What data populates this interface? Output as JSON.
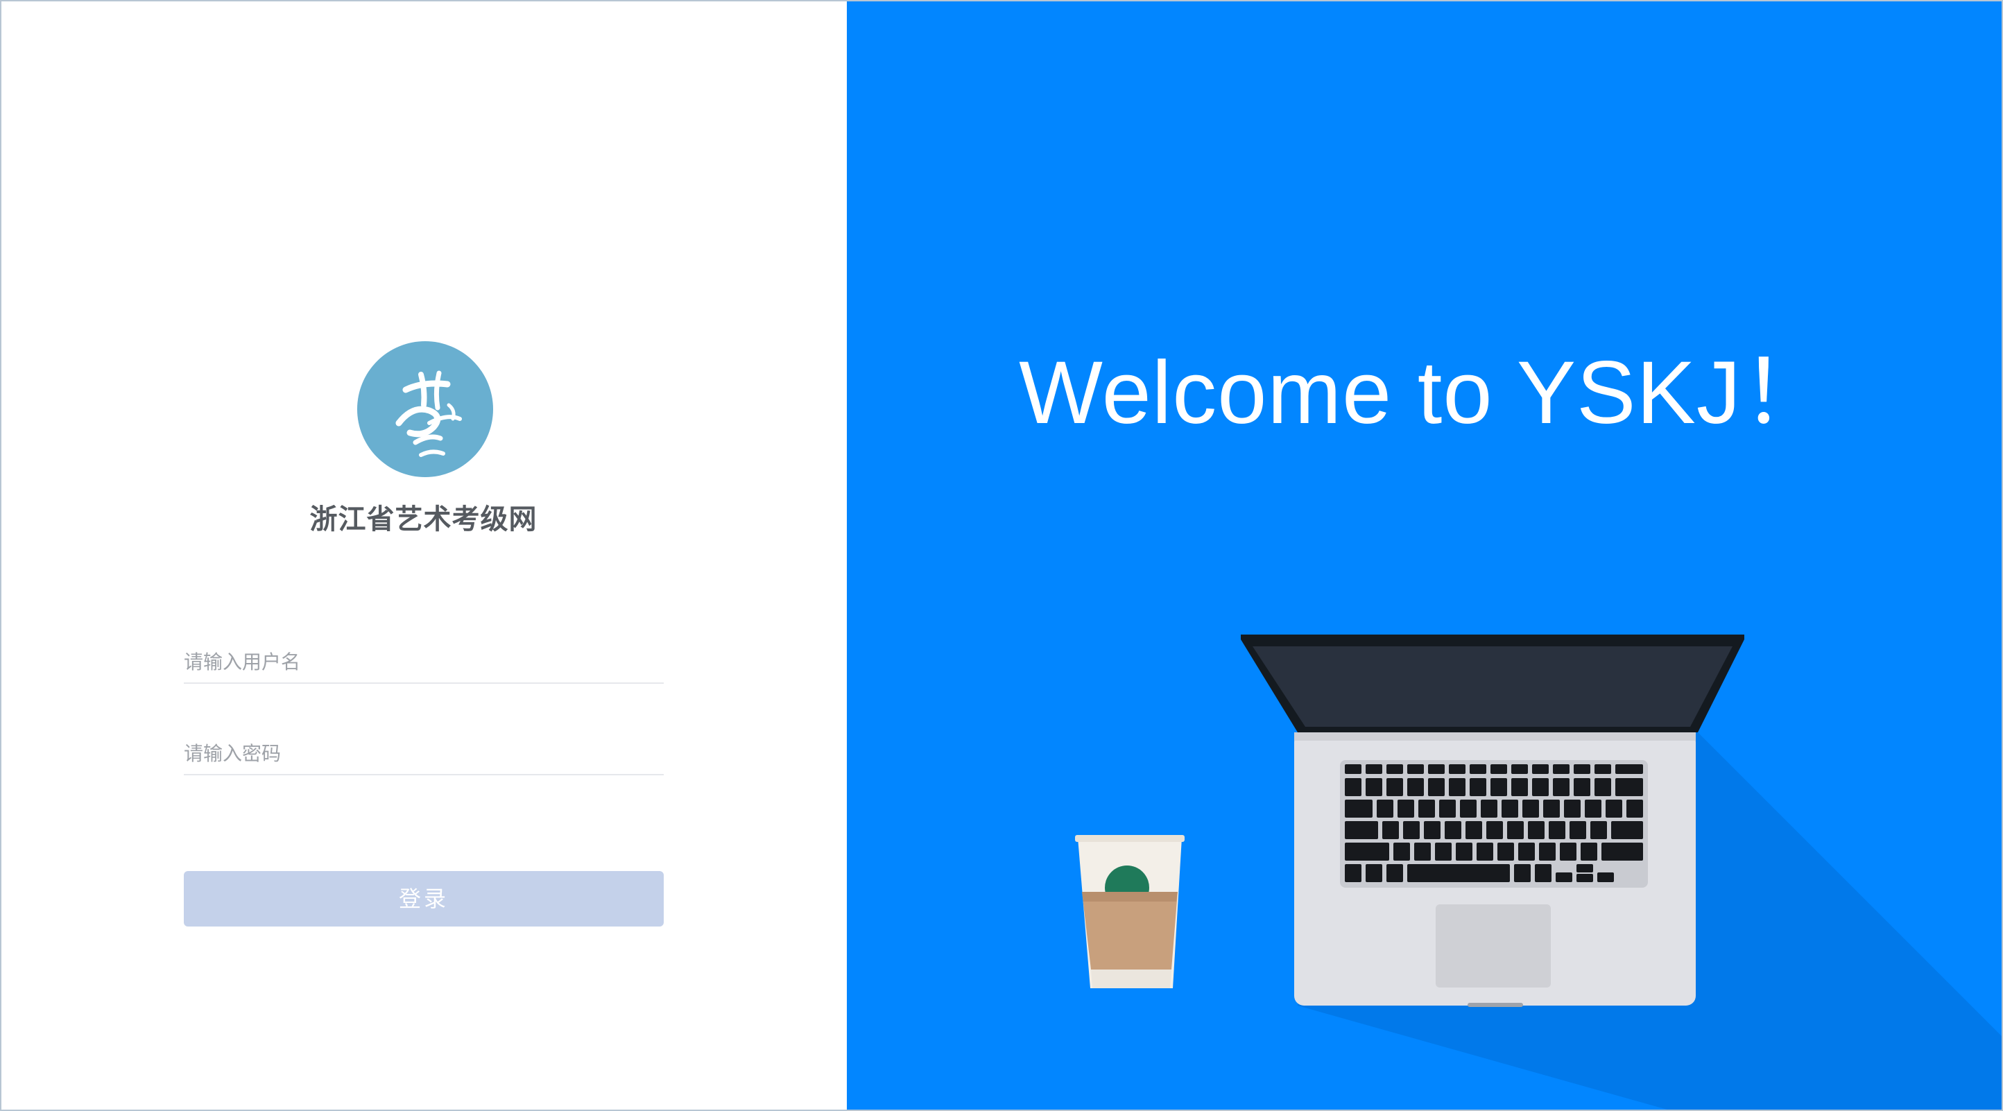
{
  "brand": {
    "logo_icon": "yi-calligraphy-logo",
    "name": "浙江省艺术考级网"
  },
  "login": {
    "username_placeholder": "请输入用户名",
    "password_placeholder": "请输入密码",
    "submit_label": "登录"
  },
  "hero": {
    "welcome_text": "Welcome to YSKJ！"
  },
  "colors": {
    "hero_background": "#0286ff",
    "logo_background": "#69afd0",
    "button_disabled": "#c4d1ea"
  }
}
